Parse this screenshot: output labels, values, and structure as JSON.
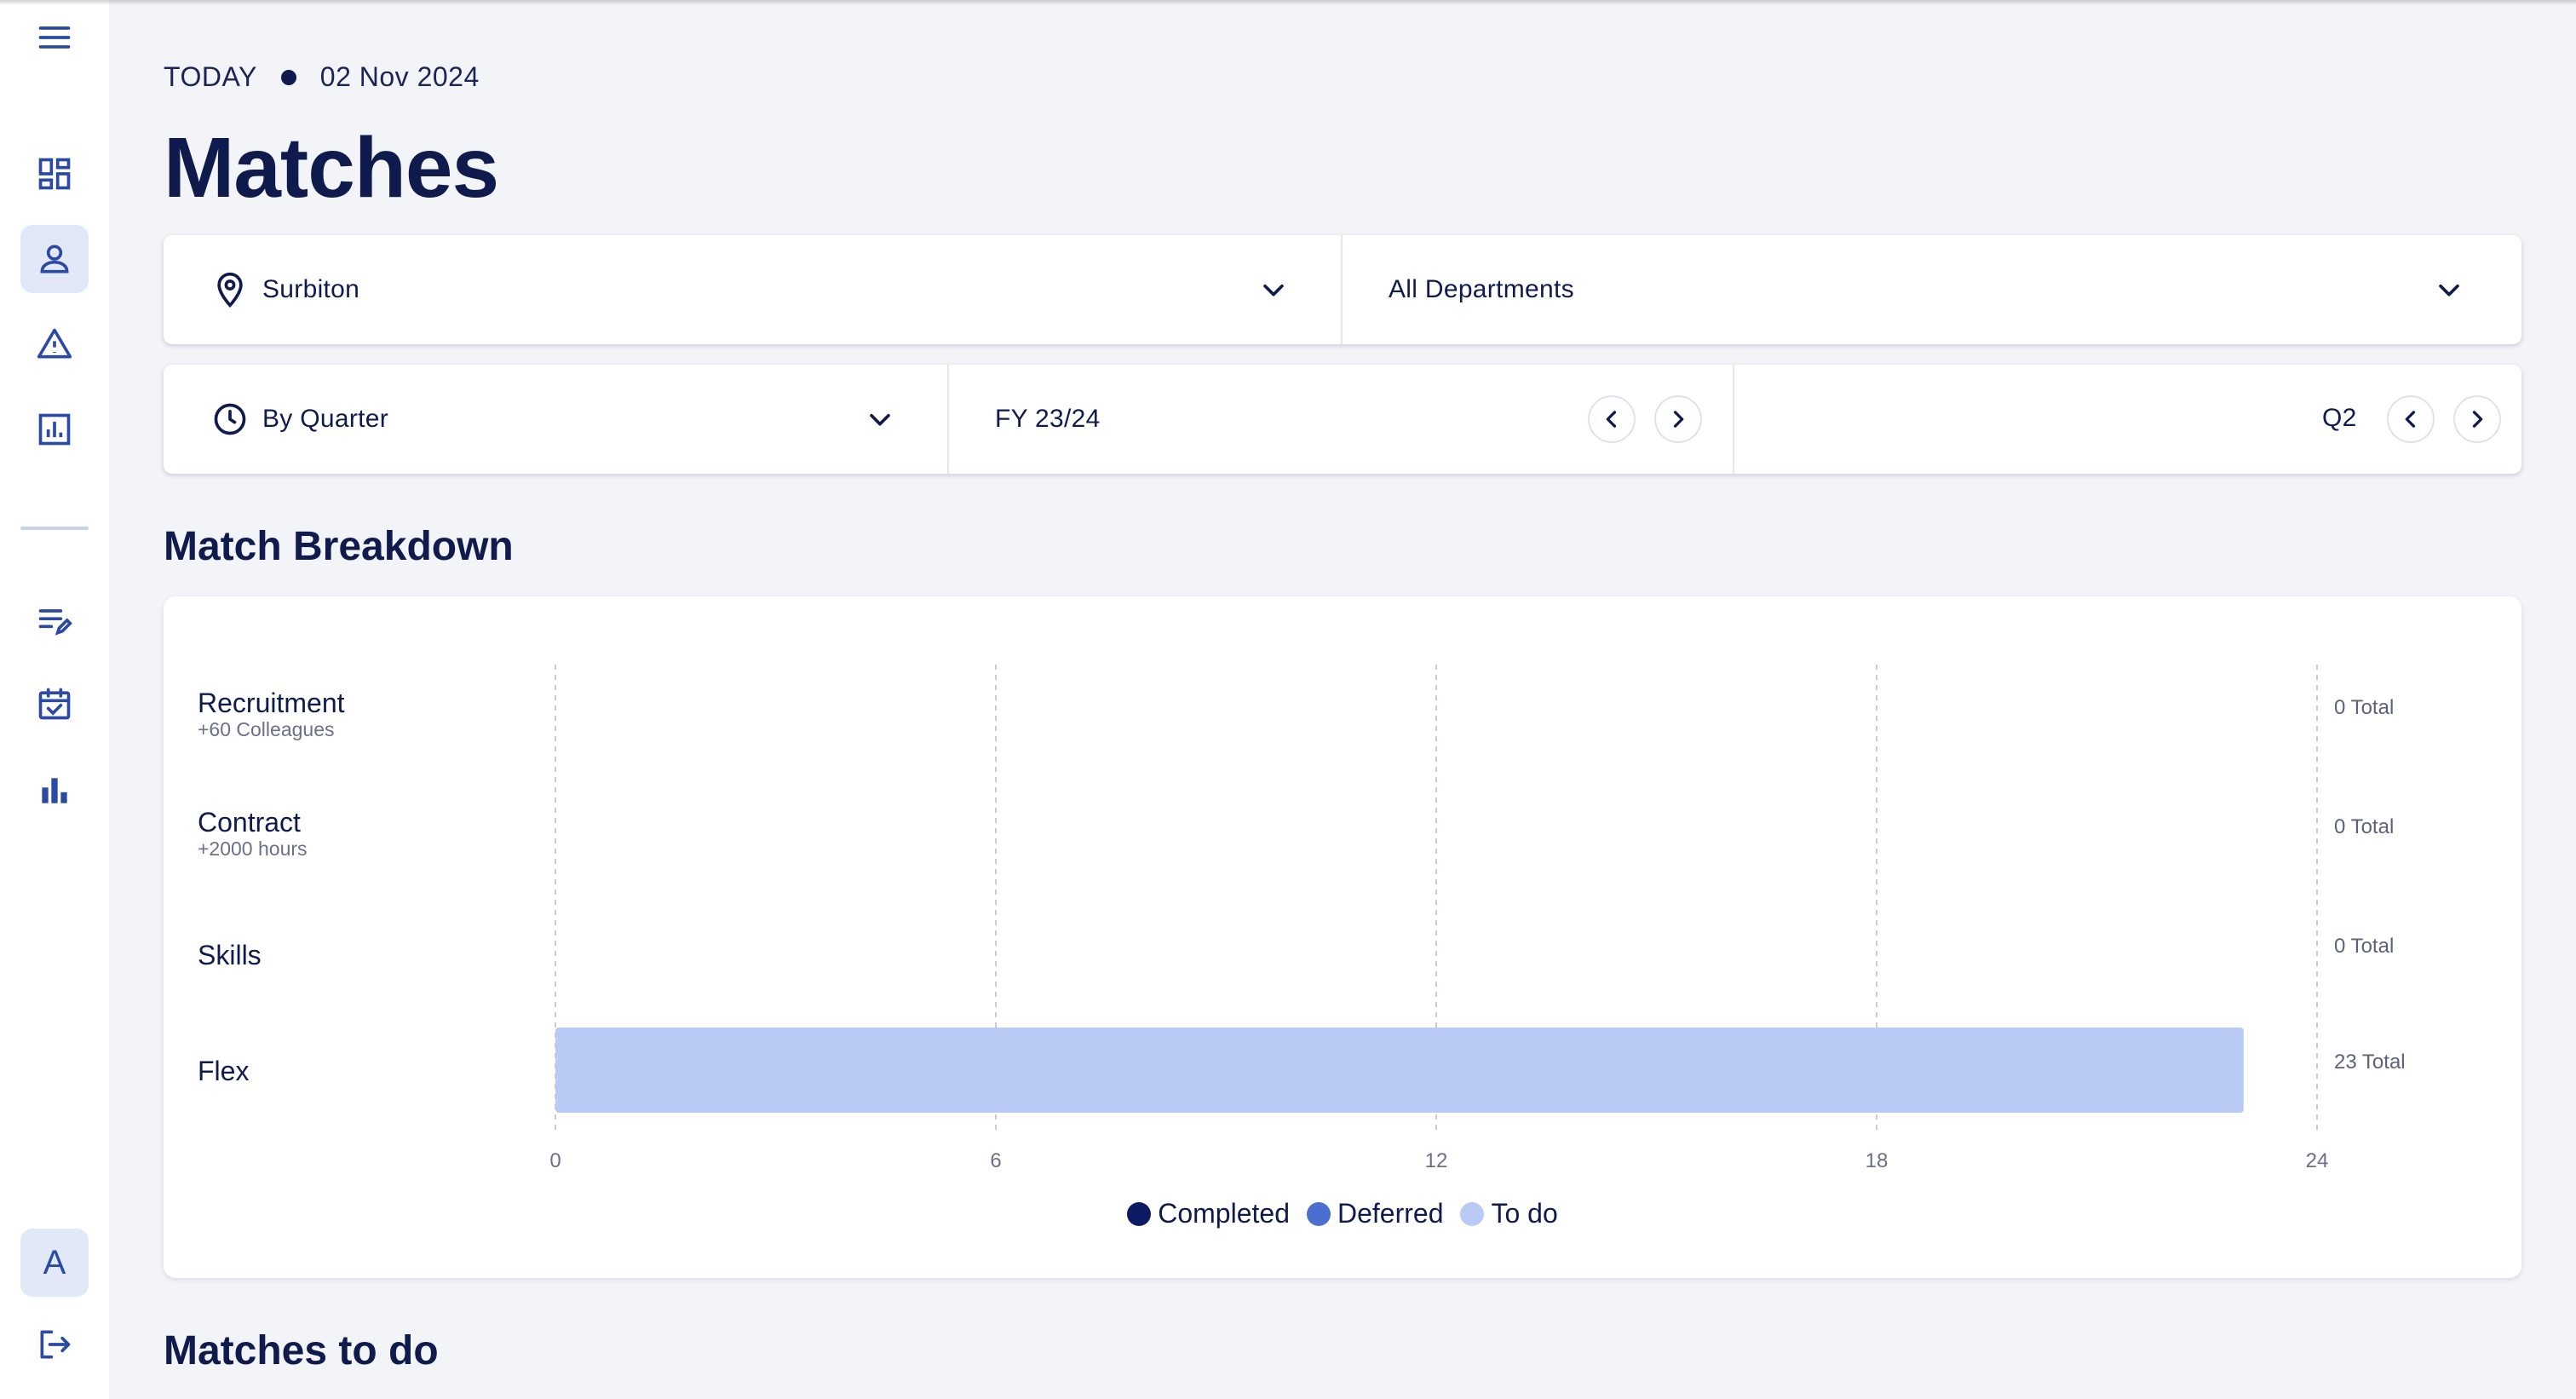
{
  "header": {
    "today_label": "TODAY",
    "date": "02 Nov 2024",
    "title": "Matches"
  },
  "sidebar": {
    "items": [
      {
        "icon": "menu-icon"
      },
      {
        "icon": "dashboard-icon"
      },
      {
        "icon": "person-icon",
        "active": true
      },
      {
        "icon": "warning-icon"
      },
      {
        "icon": "report-icon"
      },
      {
        "icon": "edit-list-icon"
      },
      {
        "icon": "calendar-check-icon"
      },
      {
        "icon": "bar-chart-icon"
      }
    ],
    "avatar_initial": "A",
    "logout_icon": "logout-icon"
  },
  "filters": {
    "location": "Surbiton",
    "department": "All Departments",
    "period_type": "By Quarter",
    "fiscal_year": "FY 23/24",
    "quarter": "Q2"
  },
  "sections": {
    "breakdown_title": "Match Breakdown",
    "todo_title": "Matches to do"
  },
  "colors": {
    "completed": "#0b1a63",
    "deferred": "#4a6fd1",
    "todo": "#b9cbf5",
    "navy": "#0f1b4c"
  },
  "chart_data": {
    "type": "bar",
    "orientation": "horizontal",
    "stacked": true,
    "categories": [
      {
        "name": "Recruitment",
        "sub": "+60 Colleagues",
        "total": "0 Total"
      },
      {
        "name": "Contract",
        "sub": "+2000 hours",
        "total": "0 Total"
      },
      {
        "name": "Skills",
        "sub": "",
        "total": "0 Total"
      },
      {
        "name": "Flex",
        "sub": "",
        "total": "23 Total"
      }
    ],
    "series": [
      {
        "name": "Completed",
        "values": [
          0,
          0,
          0,
          0
        ]
      },
      {
        "name": "Deferred",
        "values": [
          0,
          0,
          0,
          0
        ]
      },
      {
        "name": "To do",
        "values": [
          0,
          0,
          0,
          23
        ]
      }
    ],
    "xlim": [
      0,
      24
    ],
    "xticks": [
      "0",
      "6",
      "12",
      "18",
      "24"
    ],
    "grid": true,
    "legend_position": "bottom-center"
  }
}
